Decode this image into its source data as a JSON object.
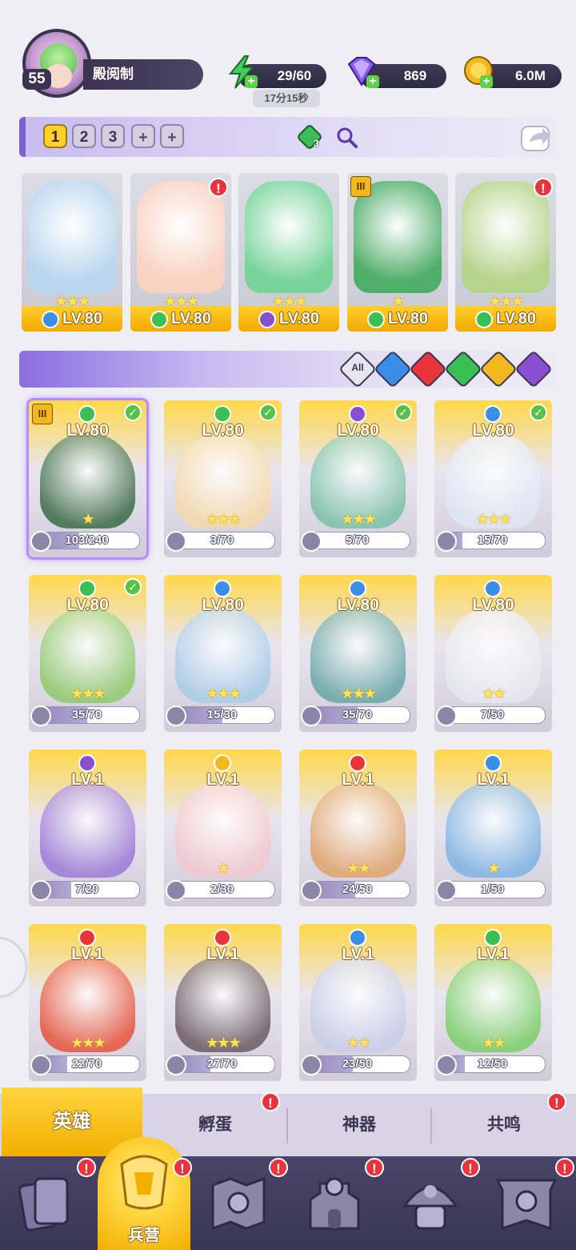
{
  "player": {
    "level": "55",
    "name": "殿阅制"
  },
  "resources": {
    "energy": {
      "value": "29/60",
      "timer": "17分15秒",
      "icon": "lightning-icon",
      "color": "#3fcf5a"
    },
    "gems": {
      "value": "869",
      "icon": "gem-icon",
      "color": "#8a5cf0"
    },
    "gold": {
      "value": "6.0M",
      "icon": "coin-icon",
      "color": "#f2b81e"
    }
  },
  "team_tabs": [
    "1",
    "2",
    "3",
    "+",
    "+"
  ],
  "team_active": "1",
  "team_tools": {
    "clover_count": "3"
  },
  "team_slots": [
    {
      "level": "LV.80",
      "element": "water",
      "stars": "★★★",
      "alert": "",
      "tier": "",
      "art": "#b9d6ef"
    },
    {
      "level": "LV.80",
      "element": "wind",
      "stars": "★★★",
      "alert": "!",
      "tier": "",
      "art": "#f9d2c2"
    },
    {
      "level": "LV.80",
      "element": "dark",
      "stars": "★★★",
      "alert": "",
      "tier": "",
      "art": "#79d49b"
    },
    {
      "level": "LV.80",
      "element": "wind",
      "stars": "★",
      "alert": "",
      "tier": "III",
      "art": "#4fae6a"
    },
    {
      "level": "LV.80",
      "element": "wind",
      "stars": "★★★",
      "alert": "!",
      "tier": "",
      "art": "#b6d48c"
    }
  ],
  "filters": [
    {
      "id": "all",
      "label": "All",
      "color": "#e6e6ee"
    },
    {
      "id": "water",
      "label": "",
      "color": "#3a8ee8"
    },
    {
      "id": "fire",
      "label": "",
      "color": "#e8343a"
    },
    {
      "id": "wind",
      "label": "",
      "color": "#3abf55"
    },
    {
      "id": "light",
      "label": "",
      "color": "#f2b81e"
    },
    {
      "id": "dark",
      "label": "",
      "color": "#8a4fd0"
    }
  ],
  "element_colors": {
    "water": "#3a8ee8",
    "fire": "#e8343a",
    "wind": "#3abf55",
    "light": "#f2b81e",
    "dark": "#8a4fd0"
  },
  "heroes": [
    {
      "level": "LV.80",
      "element": "wind",
      "shards": "103/240",
      "progress": 0.43,
      "stars": "★",
      "checked": true,
      "tier": "III",
      "selected": true,
      "art": "#3b6b46"
    },
    {
      "level": "LV.80",
      "element": "wind",
      "shards": "3/70",
      "progress": 0.04,
      "stars": "★★★",
      "checked": true,
      "tier": "",
      "selected": false,
      "art": "#f6d9a9"
    },
    {
      "level": "LV.80",
      "element": "dark",
      "shards": "5/70",
      "progress": 0.07,
      "stars": "★★★",
      "checked": true,
      "tier": "",
      "selected": false,
      "art": "#7cc1a8"
    },
    {
      "level": "LV.80",
      "element": "water",
      "shards": "15/70",
      "progress": 0.21,
      "stars": "★★★",
      "checked": true,
      "tier": "",
      "selected": false,
      "art": "#dfe6f3"
    },
    {
      "level": "LV.80",
      "element": "wind",
      "shards": "35/70",
      "progress": 0.5,
      "stars": "★★★",
      "checked": true,
      "tier": "",
      "selected": false,
      "art": "#8fc96c"
    },
    {
      "level": "LV.80",
      "element": "water",
      "shards": "15/30",
      "progress": 0.5,
      "stars": "★★★",
      "checked": false,
      "tier": "",
      "selected": false,
      "art": "#a9cbe8"
    },
    {
      "level": "LV.80",
      "element": "water",
      "shards": "35/70",
      "progress": 0.5,
      "stars": "★★★",
      "checked": false,
      "tier": "",
      "selected": false,
      "art": "#6aa6a6"
    },
    {
      "level": "LV.80",
      "element": "water",
      "shards": "7/50",
      "progress": 0.14,
      "stars": "★★",
      "checked": false,
      "tier": "",
      "selected": false,
      "art": "#e7e8ef"
    },
    {
      "level": "LV.1",
      "element": "dark",
      "shards": "7/20",
      "progress": 0.35,
      "stars": "",
      "checked": false,
      "tier": "",
      "selected": false,
      "art": "#9b7ad6"
    },
    {
      "level": "LV.1",
      "element": "light",
      "shards": "2/30",
      "progress": 0.07,
      "stars": "★",
      "checked": false,
      "tier": "",
      "selected": false,
      "art": "#f3c7cf"
    },
    {
      "level": "LV.1",
      "element": "fire",
      "shards": "24/50",
      "progress": 0.48,
      "stars": "★★",
      "checked": false,
      "tier": "",
      "selected": false,
      "art": "#e0a36b"
    },
    {
      "level": "LV.1",
      "element": "water",
      "shards": "1/50",
      "progress": 0.02,
      "stars": "★",
      "checked": false,
      "tier": "",
      "selected": false,
      "art": "#7fb3e3"
    },
    {
      "level": "LV.1",
      "element": "fire",
      "shards": "22/70",
      "progress": 0.31,
      "stars": "★★★",
      "checked": false,
      "tier": "",
      "selected": false,
      "art": "#e6543c"
    },
    {
      "level": "LV.1",
      "element": "fire",
      "shards": "27/70",
      "progress": 0.39,
      "stars": "★★★",
      "checked": false,
      "tier": "",
      "selected": false,
      "art": "#6b5a64"
    },
    {
      "level": "LV.1",
      "element": "water",
      "shards": "23/50",
      "progress": 0.46,
      "stars": "★★",
      "checked": false,
      "tier": "",
      "selected": false,
      "art": "#c8cde8"
    },
    {
      "level": "LV.1",
      "element": "wind",
      "shards": "12/50",
      "progress": 0.24,
      "stars": "★★",
      "checked": false,
      "tier": "",
      "selected": false,
      "art": "#7ccf6a"
    }
  ],
  "subtabs": [
    {
      "label": "英雄",
      "alert": false,
      "active": true
    },
    {
      "label": "孵蛋",
      "alert": true,
      "active": false
    },
    {
      "label": "神器",
      "alert": false,
      "active": false
    },
    {
      "label": "共鸣",
      "alert": true,
      "active": false
    }
  ],
  "bottom_nav": [
    {
      "icon": "cards-icon",
      "label": "",
      "alert": true
    },
    {
      "icon": "barracks-icon",
      "label": "兵营",
      "alert": true,
      "active": true
    },
    {
      "icon": "map-icon",
      "label": "",
      "alert": true
    },
    {
      "icon": "castle-icon",
      "label": "",
      "alert": true
    },
    {
      "icon": "mushroom-house-icon",
      "label": "",
      "alert": true
    },
    {
      "icon": "guild-banner-icon",
      "label": "",
      "alert": true
    }
  ],
  "alert_mark": "!"
}
